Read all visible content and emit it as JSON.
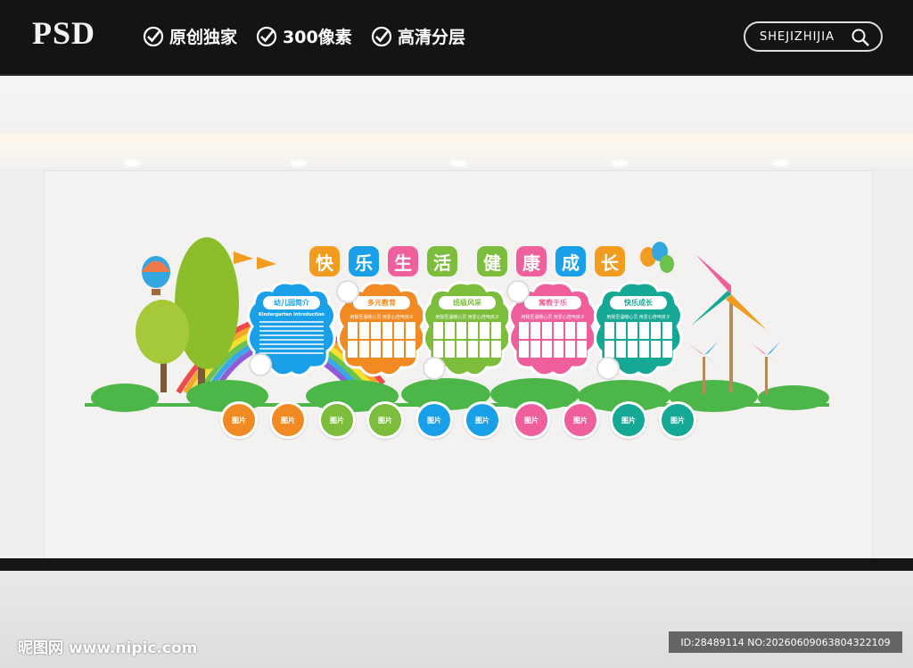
{
  "header": {
    "logo": "PSD",
    "features": [
      "原创独家",
      "300像素",
      "高清分层"
    ],
    "search_label": "SHEJIZHIJIA"
  },
  "wall": {
    "title_chars": [
      "快",
      "乐",
      "生",
      "活",
      "健",
      "康",
      "成",
      "长"
    ],
    "intro": {
      "heading": "幼儿园简介",
      "subheading": "Kindergarten Introduction"
    },
    "sections": [
      {
        "heading": "多元教育",
        "slogan": "用我至温暖心灵 用爱心倍呵孩子",
        "color": "#f18a22"
      },
      {
        "heading": "班级风采",
        "slogan": "用我至温暖心灵 用爱心倍呵孩子",
        "color": "#7cbd3b"
      },
      {
        "heading": "寓教于乐",
        "slogan": "用我至温暖心灵 用爱心倍呵孩子",
        "color": "#ef5f9c"
      },
      {
        "heading": "快乐成长",
        "slogan": "用我至温暖心灵 用爱心倍呵孩子",
        "color": "#15a894"
      }
    ],
    "photo_label": "图片",
    "photo_colors": [
      "#f18a22",
      "#f18a22",
      "#7cbd3b",
      "#7cbd3b",
      "#1aa0e8",
      "#1aa0e8",
      "#ef5f9c",
      "#ef5f9c",
      "#15a894",
      "#15a894"
    ]
  },
  "watermark": {
    "site": "昵图网 www.nipic.com",
    "id": "ID:28489114 NO:20260609063804322109"
  }
}
